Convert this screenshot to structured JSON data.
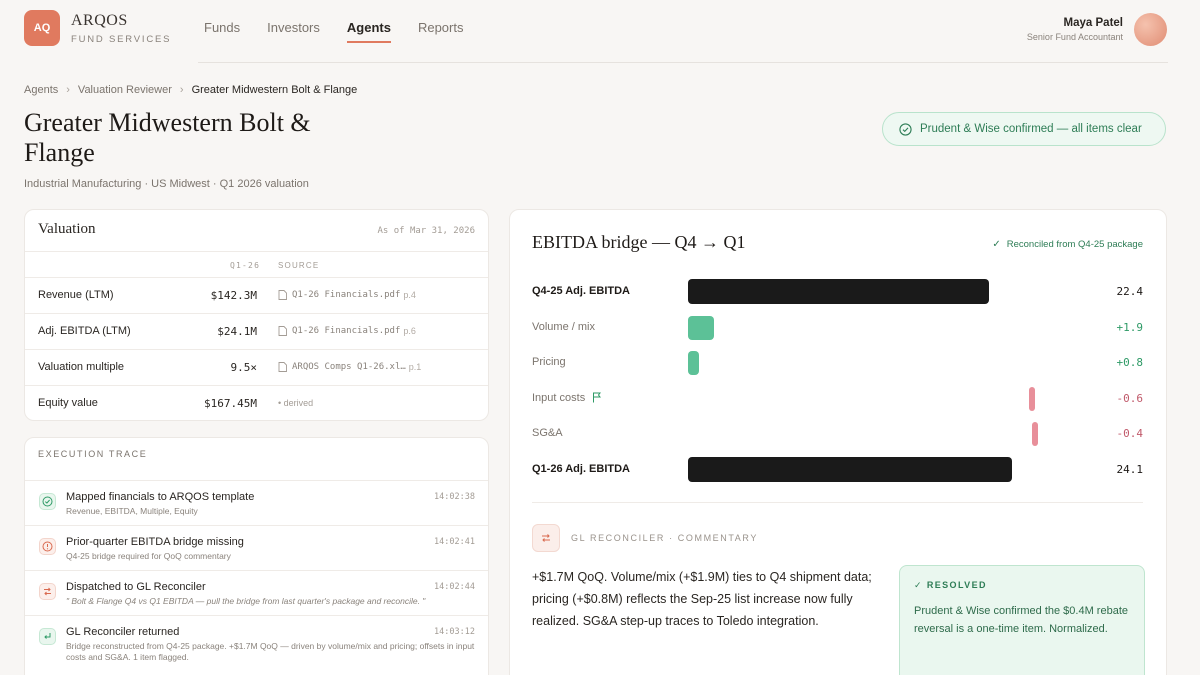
{
  "brand": {
    "logo": "AQ",
    "name": "ARQOS",
    "sub": "FUND SERVICES"
  },
  "nav": [
    {
      "label": "Funds"
    },
    {
      "label": "Investors"
    },
    {
      "label": "Agents",
      "active": true
    },
    {
      "label": "Reports"
    }
  ],
  "user": {
    "name": "Maya Patel",
    "role": "Senior Fund Accountant"
  },
  "breadcrumb": [
    "Agents",
    "Valuation Reviewer",
    "Greater Midwestern Bolt & Flange"
  ],
  "page": {
    "title": "Greater Midwestern Bolt & Flange",
    "subtitle": "Industrial Manufacturing · US Midwest · Q1 2026 valuation",
    "confirmation": "Prudent & Wise confirmed — all items clear"
  },
  "valuation": {
    "title": "Valuation",
    "as_of": "As of Mar 31, 2026",
    "col_period": "Q1-26",
    "col_source": "SOURCE",
    "rows": [
      {
        "label": "Revenue (LTM)",
        "value": "$142.3M",
        "source": "Q1-26 Financials.pdf",
        "page": "p.4"
      },
      {
        "label": "Adj. EBITDA (LTM)",
        "value": "$24.1M",
        "source": "Q1-26 Financials.pdf",
        "page": "p.6"
      },
      {
        "label": "Valuation multiple",
        "value": "9.5×",
        "source": "ARQOS Comps Q1-26.xl…",
        "page": "p.1"
      },
      {
        "label": "Equity value",
        "value": "$167.45M",
        "source": "• derived",
        "page": ""
      }
    ]
  },
  "trace": {
    "title": "EXECUTION TRACE",
    "items": [
      {
        "title": "Mapped financials to ARQOS template",
        "sub": "Revenue, EBITDA, Multiple, Equity",
        "time": "14:02:38",
        "kind": "success"
      },
      {
        "title": "Prior-quarter EBITDA bridge missing",
        "sub": "Q4-25 bridge required for QoQ commentary",
        "time": "14:02:41",
        "kind": "warning"
      },
      {
        "title": "Dispatched to GL Reconciler",
        "sub": "\" Bolt & Flange Q4 vs Q1 EBITDA — pull the bridge from last quarter's package and reconcile. \"",
        "time": "14:02:44",
        "kind": "dispatch"
      },
      {
        "title": "GL Reconciler returned",
        "sub": "Bridge reconstructed from Q4-25 package. +$1.7M QoQ — driven by volume/mix and pricing; offsets in input costs and SG&A. 1 item flagged.",
        "time": "14:03:12",
        "kind": "return"
      }
    ]
  },
  "bridge": {
    "title": "EBITDA bridge — Q4 → Q1",
    "reconciled": "Reconciled from Q4-25 package",
    "commentary_head": "GL RECONCILER · COMMENTARY",
    "commentary": "+$1.7M QoQ. Volume/mix (+$1.9M) ties to Q4 shipment data; pricing (+$0.8M) reflects the Sep-25 list increase now fully realized. SG&A step-up traces to Toledo integration.",
    "resolved_head": "RESOLVED",
    "resolved_text": "Prudent & Wise confirmed the $0.4M rebate reversal is a one-time item. Normalized."
  },
  "colors": {
    "accent": "#e07a5f",
    "positive": "#5cc197",
    "negative": "#e88f9a",
    "total": "#1a1a1a"
  },
  "chart_data": {
    "type": "bar",
    "categories": [
      "Q4-25 Adj. EBITDA",
      "Volume / mix",
      "Pricing",
      "Input costs",
      "SG&A",
      "Q1-26 Adj. EBITDA"
    ],
    "values": [
      22.4,
      1.9,
      0.8,
      -0.6,
      -0.4,
      24.1
    ],
    "labels": [
      "22.4",
      "+1.9",
      "+0.8",
      "-0.6",
      "-0.4",
      "24.1"
    ],
    "kinds": [
      "total",
      "delta",
      "delta",
      "delta",
      "delta",
      "total"
    ],
    "flagged": [
      "Input costs"
    ]
  }
}
